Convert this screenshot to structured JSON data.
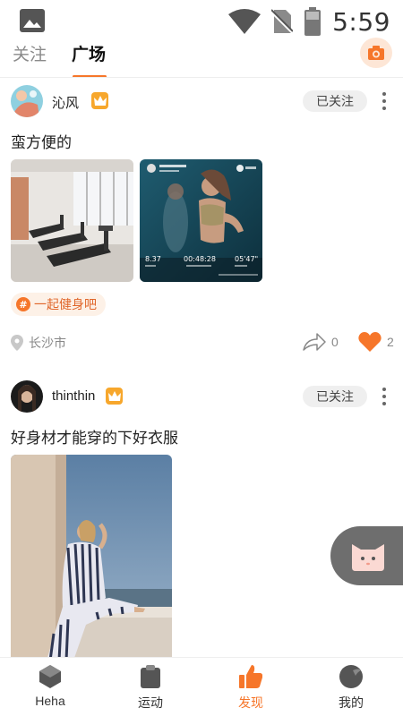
{
  "status_bar": {
    "time": "5:59"
  },
  "tabs": {
    "follow": "关注",
    "square": "广场"
  },
  "posts": [
    {
      "username": "沁风",
      "follow_label": "已关注",
      "text": "蛮方便的",
      "topic": "一起健身吧",
      "location": "长沙市",
      "shares": "0",
      "likes": "2",
      "workout_overlay": {
        "distance": "8.37",
        "duration": "00:48:28",
        "pace": "05'47\""
      }
    },
    {
      "username": "thinthin",
      "follow_label": "已关注",
      "text": "好身材才能穿的下好衣服"
    }
  ],
  "bottom_nav": [
    {
      "label": "Heha",
      "icon": "cube-icon"
    },
    {
      "label": "运动",
      "icon": "clipboard-icon"
    },
    {
      "label": "发现",
      "icon": "thumbs-up-icon",
      "active": true
    },
    {
      "label": "我的",
      "icon": "profile-icon"
    }
  ],
  "colors": {
    "accent": "#f6762a",
    "crown": "#f7a72c",
    "like": "#f6762a",
    "float_button": "#6e6e6e"
  }
}
